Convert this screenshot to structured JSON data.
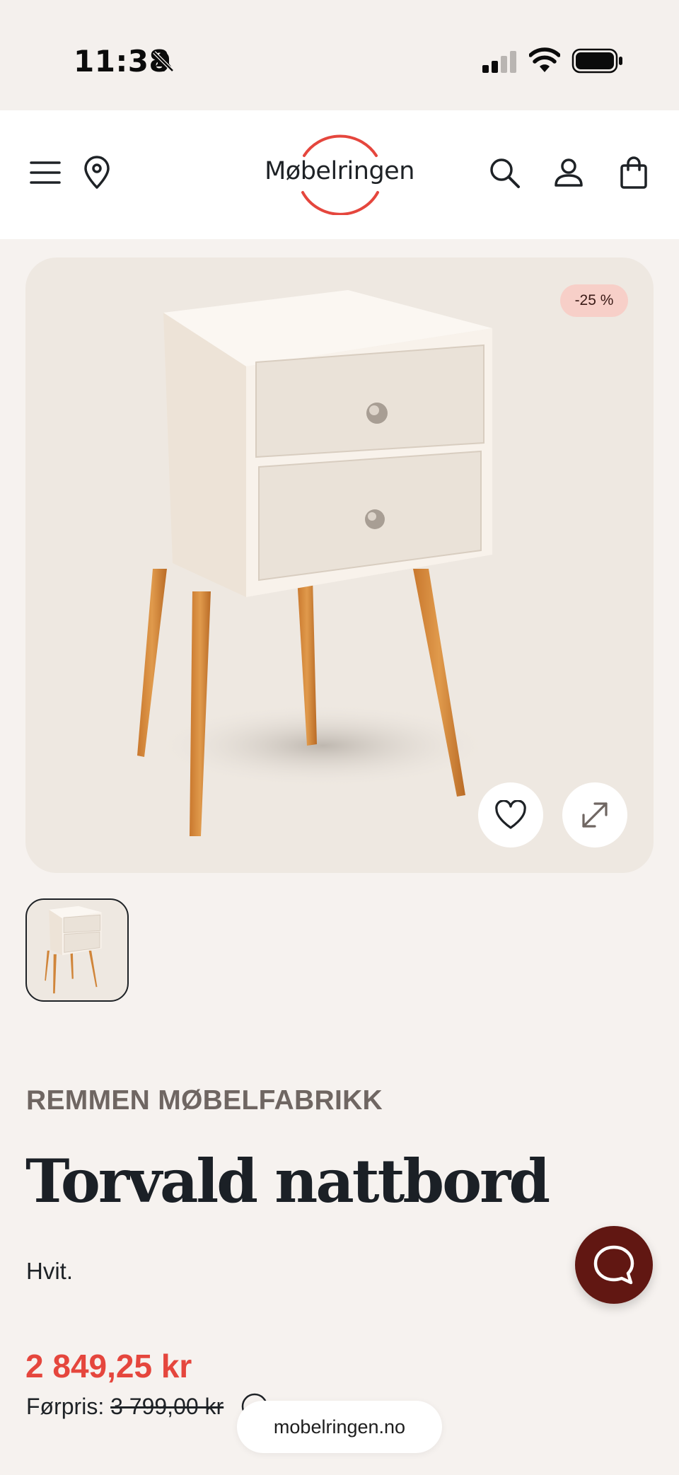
{
  "status_bar": {
    "time": "11:38",
    "icons": [
      "bell-slash-icon",
      "signal-icon",
      "wifi-icon",
      "battery-icon"
    ]
  },
  "header": {
    "logo_text": "Møbelringen",
    "icons": [
      "menu-icon",
      "location-pin-icon",
      "search-icon",
      "user-icon",
      "bag-icon"
    ],
    "brand_color": "#e5463d"
  },
  "product": {
    "discount_badge": "-25 %",
    "brand": "REMMEN MØBELFABRIKK",
    "title": "Torvald nattbord",
    "color": "Hvit.",
    "price": "2 849,25 kr",
    "previous_price_label": "Førpris:",
    "previous_price": "3 799,00 kr",
    "image_actions": [
      "heart-icon",
      "expand-icon"
    ],
    "thumbnails": 1
  },
  "chat": {
    "icon": "chat-bubble-icon",
    "color": "#611712"
  },
  "browser": {
    "url": "mobelringen.no"
  }
}
